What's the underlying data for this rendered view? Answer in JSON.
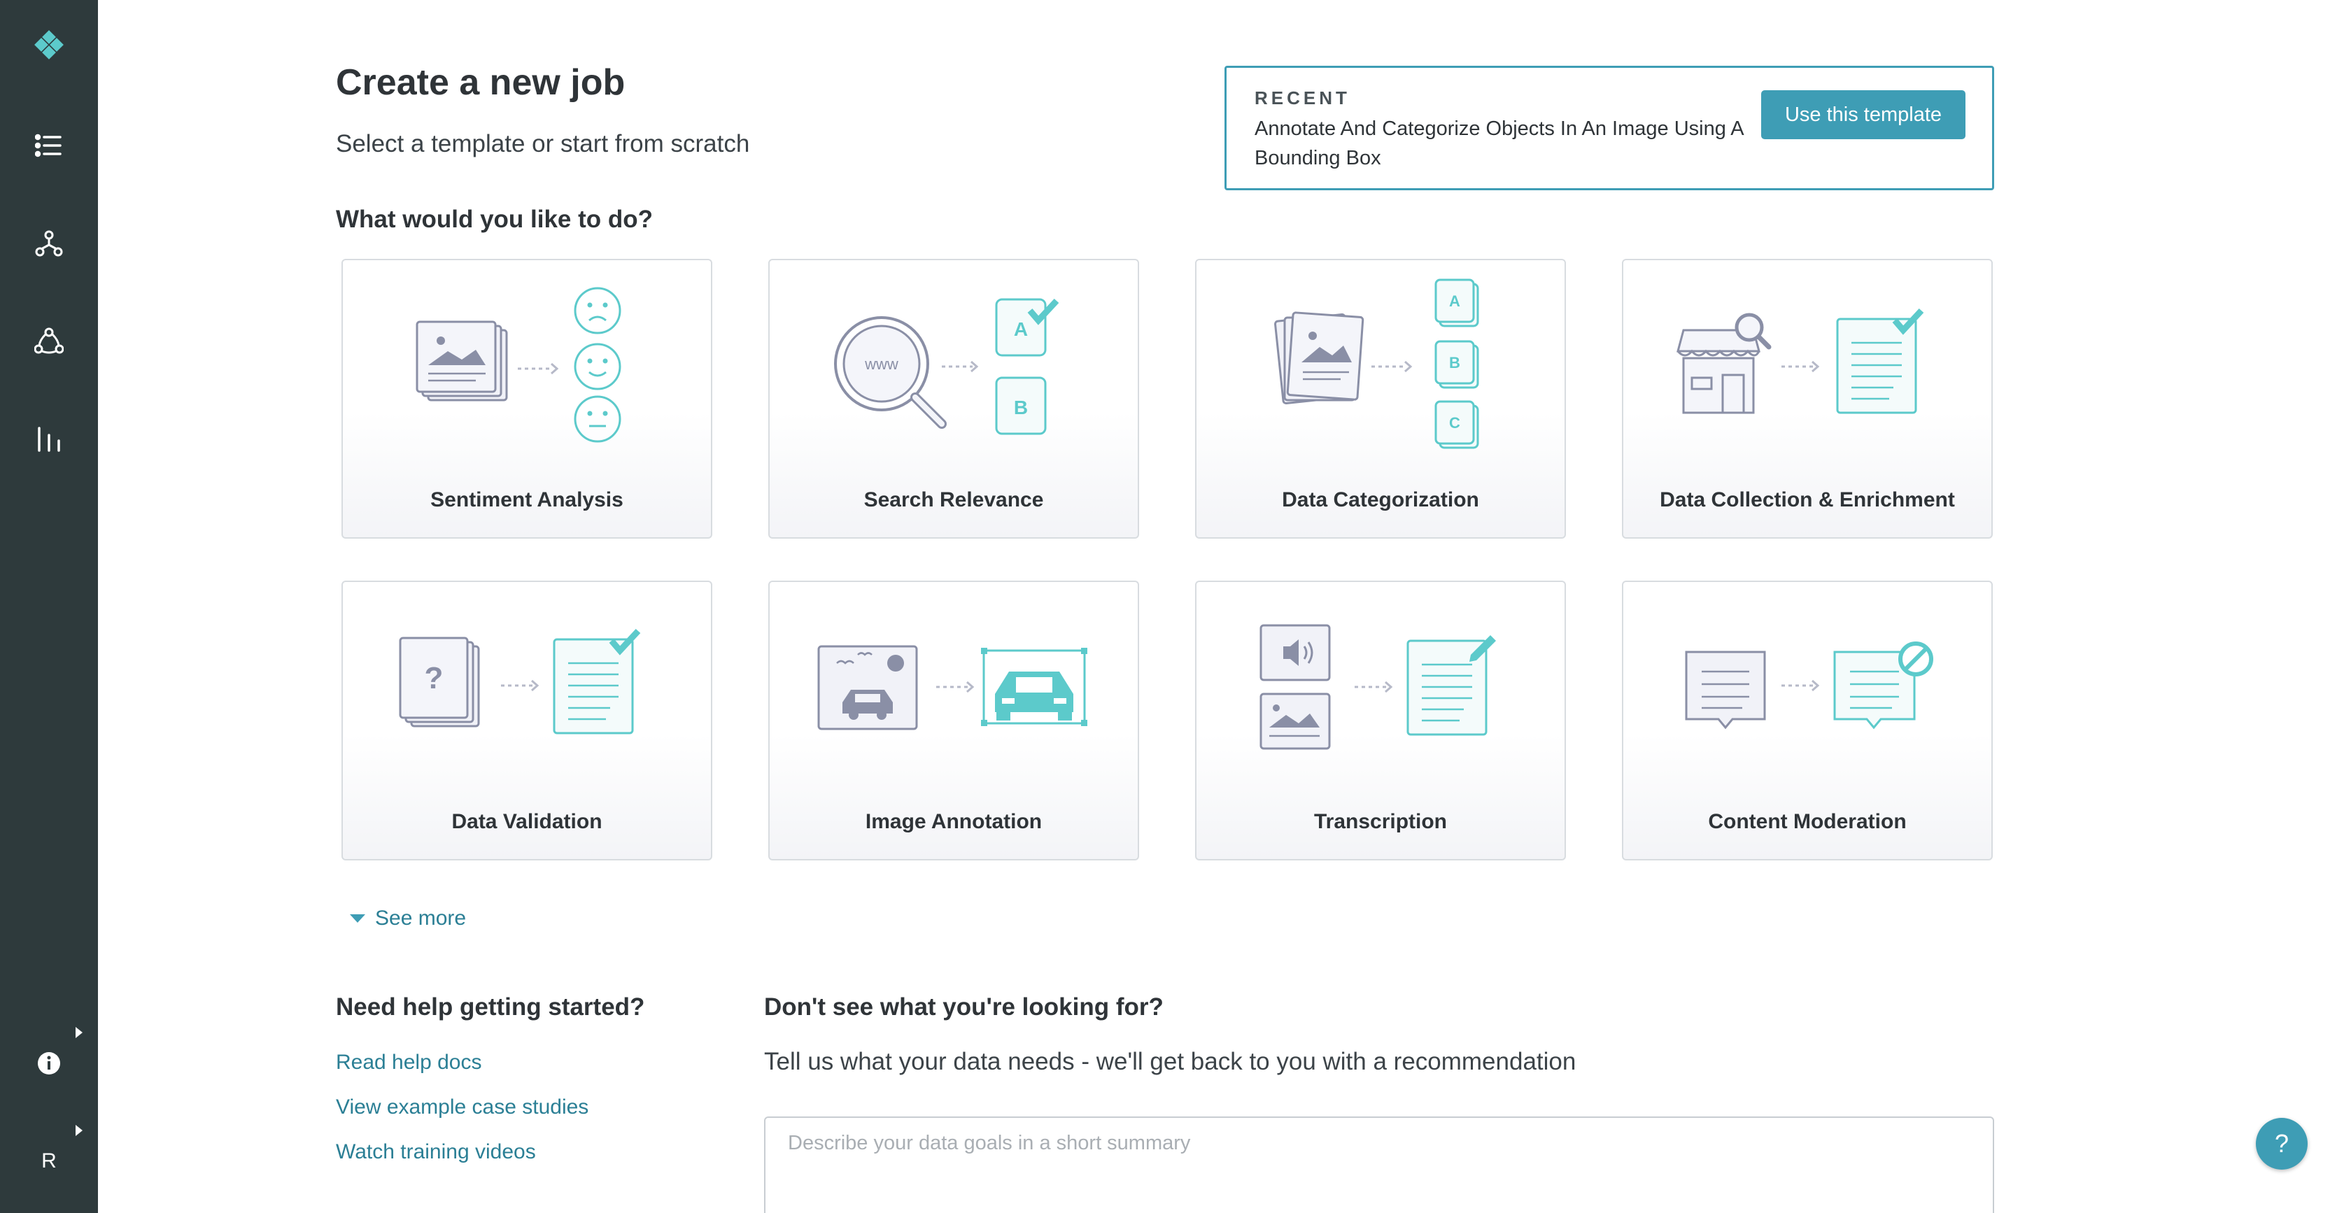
{
  "header": {
    "title": "Create a new job",
    "subtitle": "Select a template or start from scratch"
  },
  "recent": {
    "label": "RECENT",
    "template_name": "Annotate And Categorize Objects In An Image Using A Bounding Box",
    "button_label": "Use this template"
  },
  "question": "What would you like to do?",
  "cards": [
    {
      "label": "Sentiment Analysis"
    },
    {
      "label": "Search Relevance"
    },
    {
      "label": "Data Categorization"
    },
    {
      "label": "Data Collection & Enrichment"
    },
    {
      "label": "Data Validation"
    },
    {
      "label": "Image Annotation"
    },
    {
      "label": "Transcription"
    },
    {
      "label": "Content Moderation"
    }
  ],
  "see_more": "See more",
  "help": {
    "title": "Need help getting started?",
    "links": [
      "Read help docs",
      "View example case studies",
      "Watch training videos"
    ]
  },
  "request": {
    "title": "Don't see what you're looking for?",
    "subtitle": "Tell us what your data needs - we'll get back to you with a recommendation",
    "placeholder": "Describe your data goals in a short summary"
  },
  "sidebar": {
    "user_initial": "R",
    "icons": [
      "logo-icon",
      "jobs-list-icon",
      "workflows-icon",
      "contributors-icon",
      "reports-icon",
      "info-icon"
    ]
  },
  "help_button": "?",
  "colors": {
    "sidebar_bg": "#2e3a3c",
    "accent": "#3e9db5",
    "icon_teal": "#5ccacb",
    "icon_gray": "#8a8fa6"
  }
}
